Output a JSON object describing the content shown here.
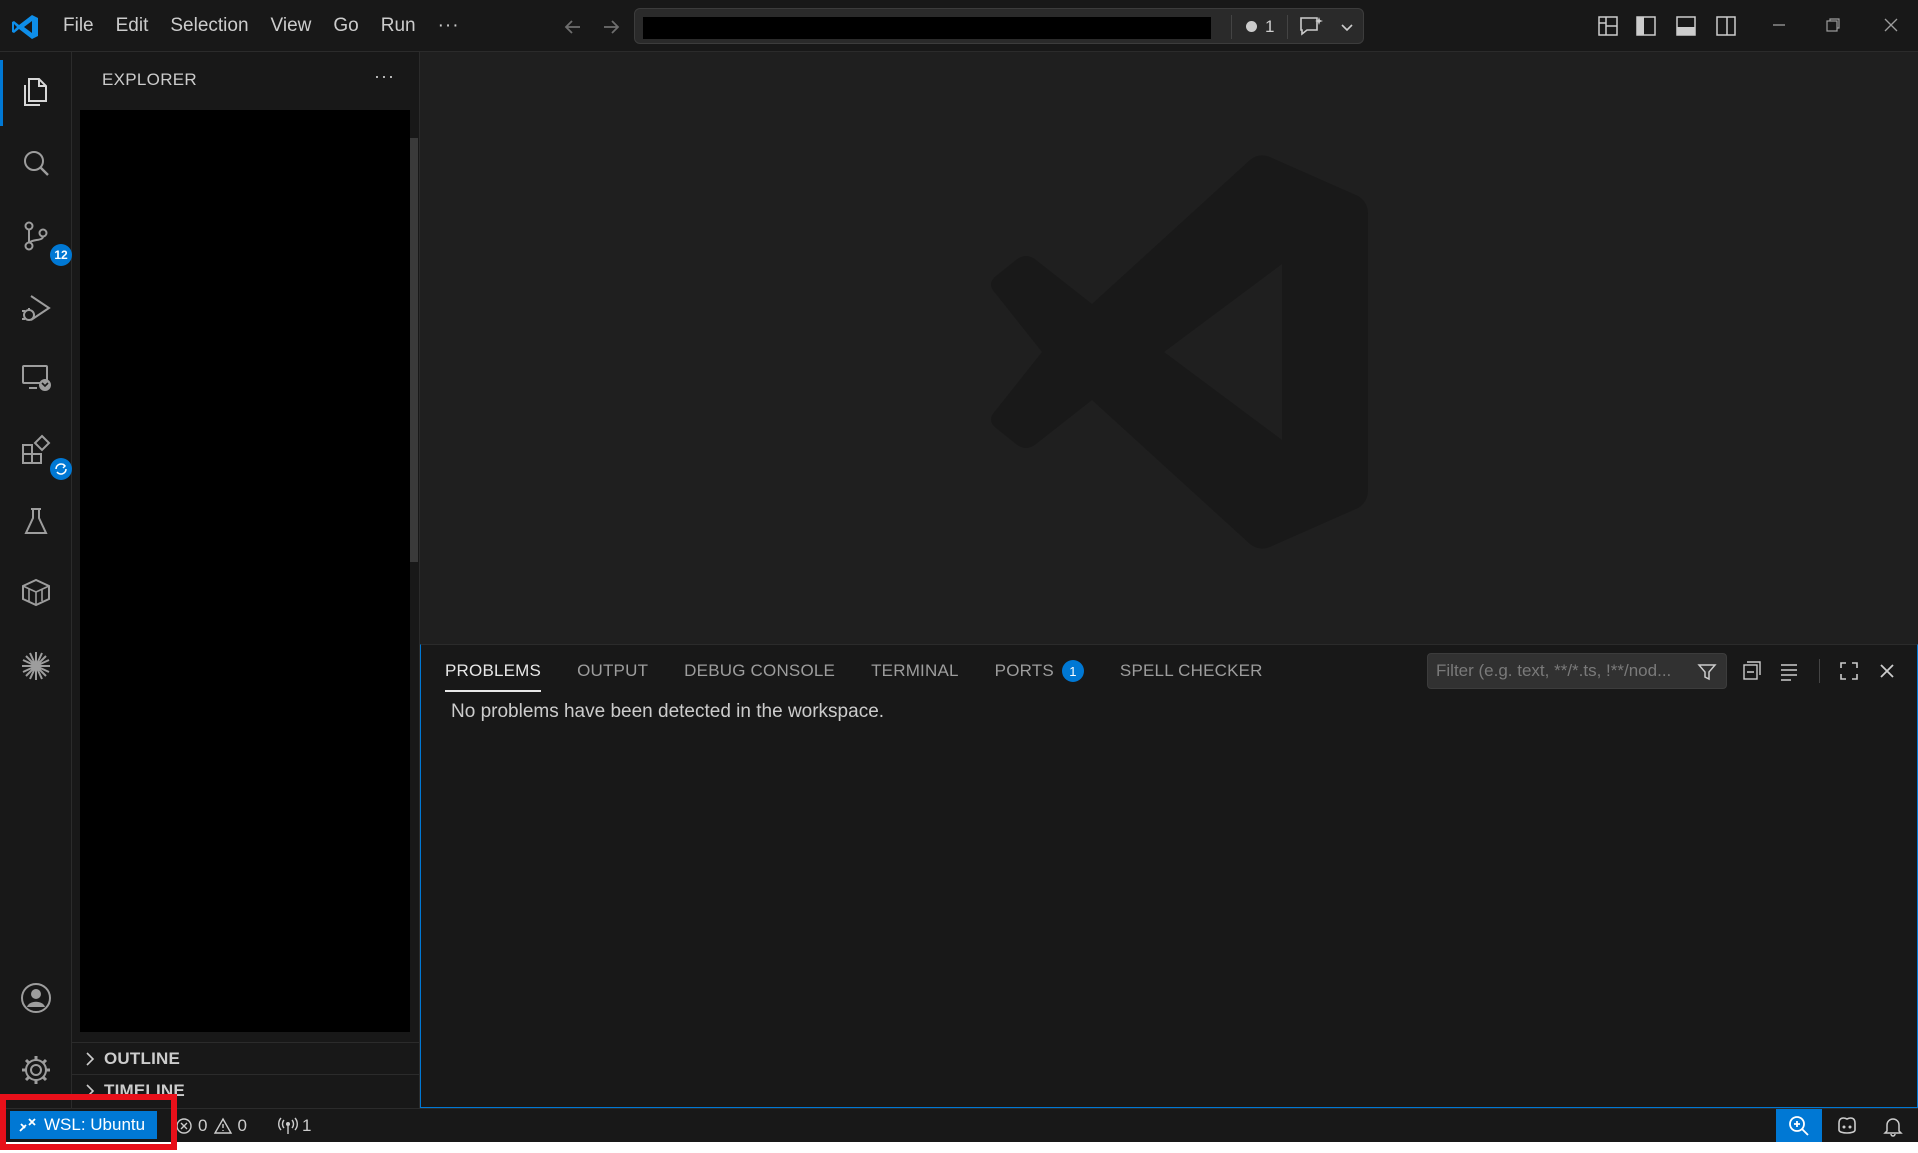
{
  "menu": {
    "items": [
      "File",
      "Edit",
      "Selection",
      "View",
      "Go",
      "Run"
    ],
    "more": "···"
  },
  "command_center": {
    "dirty_count": "1"
  },
  "sidebar": {
    "title": "EXPLORER",
    "more": "···",
    "sections": {
      "outline": "OUTLINE",
      "timeline": "TIMELINE"
    }
  },
  "activity": {
    "scm_badge": "12"
  },
  "panel": {
    "tabs": {
      "problems": "PROBLEMS",
      "output": "OUTPUT",
      "debug_console": "DEBUG CONSOLE",
      "terminal": "TERMINAL",
      "ports": "PORTS",
      "spell_checker": "SPELL CHECKER"
    },
    "ports_count": "1",
    "filter_placeholder": "Filter (e.g. text, **/*.ts, !**/nod...",
    "message": "No problems have been detected in the workspace."
  },
  "status": {
    "remote_label": "WSL: Ubuntu",
    "errors": "0",
    "warnings": "0",
    "ports": "1"
  },
  "colors": {
    "accent": "#0078d4",
    "highlight": "#e8101a"
  }
}
